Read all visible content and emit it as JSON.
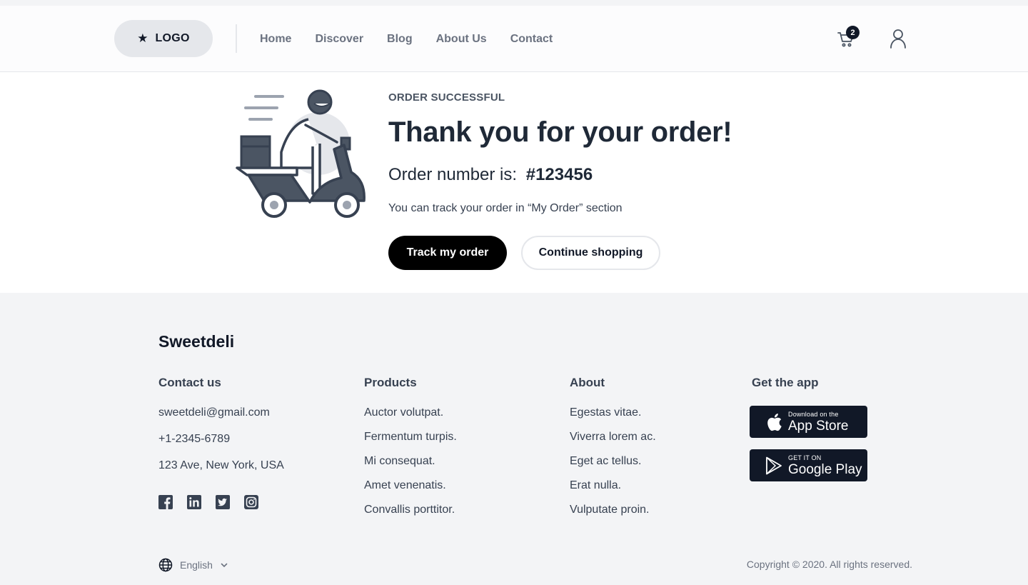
{
  "header": {
    "logo_icon": "star-icon",
    "logo_text": "LOGO",
    "nav": [
      {
        "label": "Home"
      },
      {
        "label": "Discover"
      },
      {
        "label": "Blog"
      },
      {
        "label": "About Us"
      },
      {
        "label": "Contact"
      }
    ],
    "cart_icon": "cart-icon",
    "cart_count": "2",
    "user_icon": "user-icon"
  },
  "hero": {
    "illustration_icon": "delivery-scooter-icon",
    "eyebrow": "ORDER SUCCESSFUL",
    "title": "Thank you for your order!",
    "order_label": "Order number is:",
    "order_number": "#123456",
    "track_note": "You can track your order in “My Order” section",
    "primary_button": "Track my order",
    "secondary_button": "Continue shopping"
  },
  "footer": {
    "brand": "Sweetdeli",
    "contact": {
      "heading": "Contact us",
      "items": [
        "sweetdeli@gmail.com",
        "+1-2345-6789",
        "123 Ave, New York, USA"
      ]
    },
    "social_icons": [
      "facebook-icon",
      "linkedin-icon",
      "twitter-icon",
      "instagram-icon"
    ],
    "products": {
      "heading": "Products",
      "items": [
        "Auctor volutpat.",
        "Fermentum turpis.",
        "Mi consequat.",
        "Amet venenatis.",
        "Convallis porttitor."
      ]
    },
    "about": {
      "heading": "About",
      "items": [
        "Egestas vitae.",
        "Viverra lorem ac.",
        "Eget ac tellus.",
        "Erat nulla.",
        "Vulputate proin."
      ]
    },
    "app": {
      "heading": "Get the app",
      "app_store_small": "Download on the",
      "app_store_big": "App Store",
      "google_small": "GET IT ON",
      "google_big": "Google Play"
    },
    "language": "English",
    "copyright": "Copyright © 2020. All rights reserved."
  },
  "colors": {
    "primary": "#000000",
    "text_dark": "#1f2937",
    "text_muted": "#6b7280",
    "footer_bg": "#f3f4f6",
    "scooter": "#4b5563"
  }
}
